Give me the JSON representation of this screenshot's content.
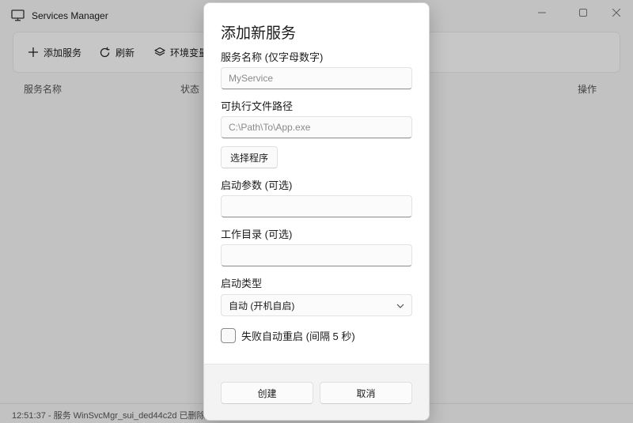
{
  "app": {
    "title": "Services Manager",
    "app_icon": "monitor-icon"
  },
  "window_controls": {
    "minimize": "minimize-icon",
    "maximize": "maximize-icon",
    "close": "close-icon"
  },
  "toolbar": {
    "add_label": "添加服务",
    "add_icon": "plus-icon",
    "refresh_label": "刷新",
    "refresh_icon": "refresh-icon",
    "env_label": "环境变量",
    "env_icon": "layers-icon"
  },
  "table": {
    "columns": [
      "服务名称",
      "状态",
      "操作"
    ]
  },
  "status_bar": {
    "text": "12:51:37 - 服务 WinSvcMgr_sui_ded44c2d 已删除。"
  },
  "dialog": {
    "title": "添加新服务",
    "name_label": "服务名称 (仅字母数字)",
    "name_placeholder": "MyService",
    "name_value": "",
    "path_label": "可执行文件路径",
    "path_placeholder": "C:\\Path\\To\\App.exe",
    "path_value": "",
    "browse_label": "选择程序",
    "args_label": "启动参数 (可选)",
    "args_value": "",
    "workdir_label": "工作目录 (可选)",
    "workdir_value": "",
    "startup_label": "启动类型",
    "startup_selected": "自动 (开机自启)",
    "restart_label": "失败自动重启 (间隔 5 秒)",
    "restart_checked": false,
    "create_label": "创建",
    "cancel_label": "取消"
  },
  "colors": {
    "window_bg": "#f3f3f3",
    "dialog_bg": "#ffffff",
    "footer_bg": "#f3f3f3",
    "text": "#1b1b1b",
    "placeholder": "#8a8a8a"
  }
}
